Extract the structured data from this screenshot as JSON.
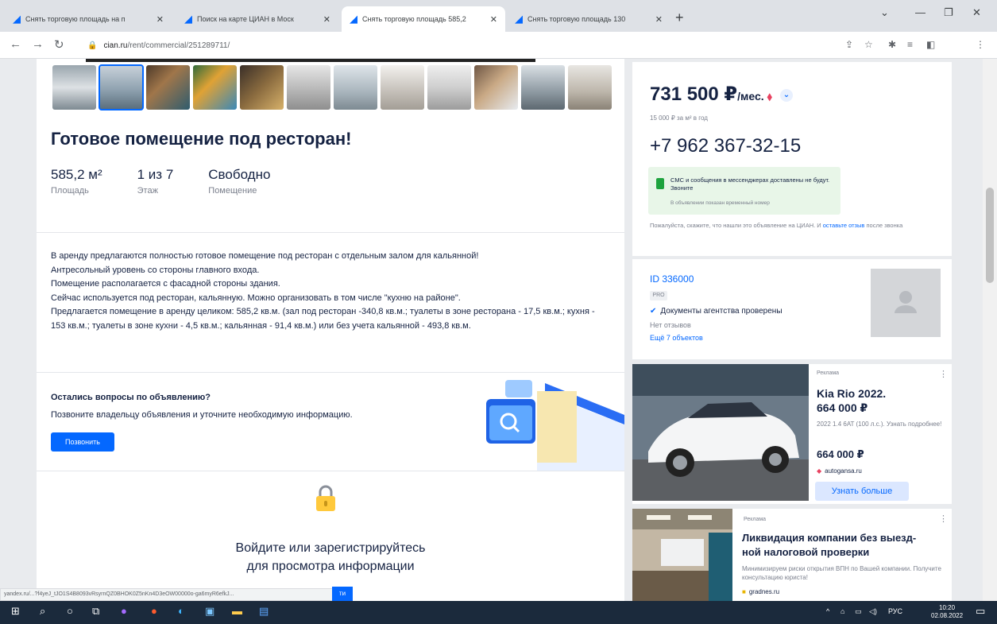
{
  "browser": {
    "tabs": [
      {
        "label": "Снять торговую площадь на п"
      },
      {
        "label": "Поиск на карте ЦИАН в Моск"
      },
      {
        "label": "Снять торговую площадь 585,2"
      },
      {
        "label": "Снять торговую площадь 130"
      }
    ],
    "active_tab": 2,
    "new_tab": "+",
    "url_host": "cian.ru",
    "url_path": "/rent/commercial/251289711/",
    "profile_initial": "Е"
  },
  "listing": {
    "title": "Готовое помещение под ресторан!",
    "facts": [
      {
        "value": "585,2 м²",
        "label": "Площадь"
      },
      {
        "value": "1 из 7",
        "label": "Этаж"
      },
      {
        "value": "Свободно",
        "label": "Помещение"
      }
    ],
    "description": [
      "В аренду предлагаются полностью готовое помещение под ресторан с отдельным залом для кальянной!",
      "Антресольный уровень со стороны главного входа.",
      "Помещение располагается с фасадной стороны здания.",
      "Сейчас используется под ресторан, кальянную. Можно организовать в том числе \"кухню на районе\".",
      "Предлагается помещение в аренду целиком: 585,2 кв.м. (зал под ресторан -340,8 кв.м.; туалеты в зоне ресторана - 17,5 кв.м.; кухня - 153 кв.м.; туалеты в зоне кухни - 4,5 кв.м.; кальянная - 91,4 кв.м.) или без учета кальянной - 493,8 кв.м."
    ],
    "questions_title": "Остались вопросы по объявлению?",
    "questions_text": "Позвоните владельцу объявления и уточните необходимую информацию.",
    "call_button": "Позвонить",
    "login_line1": "Войдите или зарегистрируйтесь",
    "login_line2": "для просмотра информации"
  },
  "sidebar": {
    "price": "731 500 ₽",
    "price_unit": "/мес.",
    "price_per_m2": "15 000 ₽ за м² в год",
    "phone": "+7 962 367-32-15",
    "sms_notice": "СМС и сообщения в мессенджерах доставлены не будут. Звоните",
    "temp_number_notice": "В объявлении показан временный номер",
    "please_text": "Пожалуйста, скажите, что нашли это объявление на ЦИАН. И ",
    "please_link": "оставьте отзыв",
    "please_tail": " после звонка",
    "agent_id": "ID 336000",
    "pro_badge": "PRO",
    "docs_verified": "Документы агентства проверены",
    "no_reviews": "Нет отзывов",
    "more_objects": "Ещё 7 объектов"
  },
  "ads": [
    {
      "label": "Реклама",
      "title_line1": "Kia Rio 2022.",
      "title_line2": "664 000 ₽",
      "subtitle": "2022 1.4 6AT (100 л.с.). Узнать подробнее!",
      "price": "664 000 ₽",
      "source": "autogansa.ru",
      "button": "Узнать больше"
    },
    {
      "label": "Реклама",
      "title_line1": "Ликвидация компании без выезд-",
      "title_line2": "ной налоговой проверки",
      "subtitle": "Минимизируем риски открытия ВПН по Вашей компании. Получите консультацию юриста!",
      "source": "gradnes.ru"
    }
  ],
  "status_url": "yandex.ru/...?f4yeJ_tJO1S4B8093vRsyrnQZ0BHOK0Z5nKn4D3eOW00000o-ga6myR6efkJ...",
  "hidden_button_fragment": "ти",
  "taskbar": {
    "tray_lang": "РУС",
    "time": "10:20",
    "date": "02.08.2022"
  },
  "colors": {
    "brand_blue": "#0468ff",
    "price_arrow": "#e84260",
    "sms_green": "#1ea33e",
    "taskbar": "#1b2a3c"
  }
}
